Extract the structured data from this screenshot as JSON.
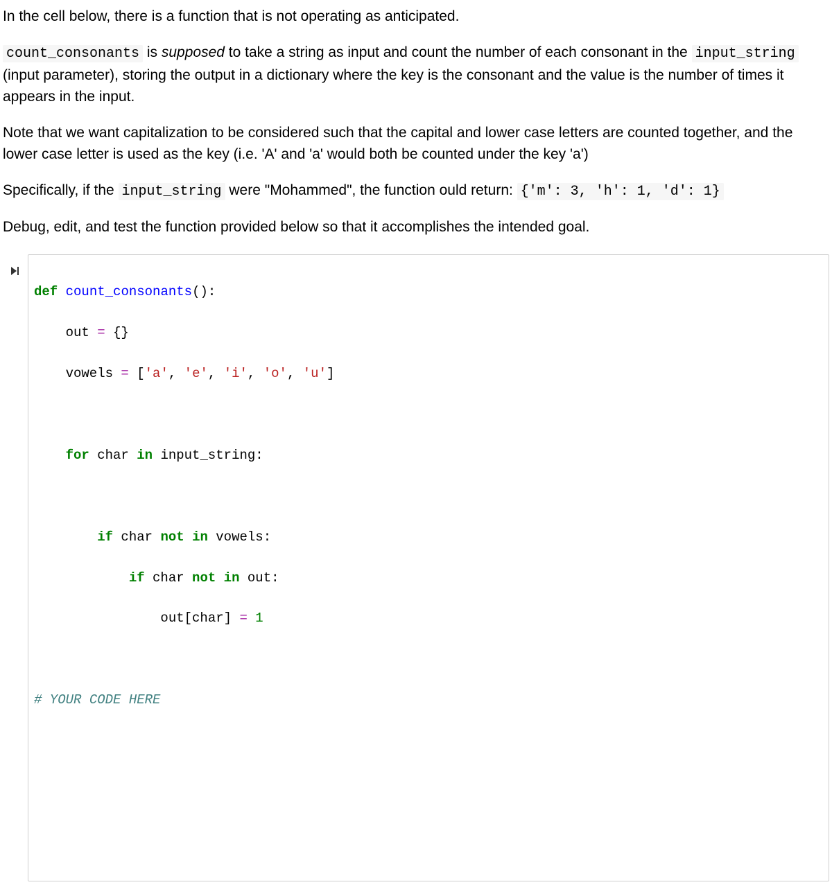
{
  "prose": {
    "p1": "In the cell below, there is a function that is not operating as anticipated.",
    "p2a": "count_consonants",
    "p2b": " is ",
    "p2c": "supposed",
    "p2d": " to take a string as input and count the number of each consonant in the ",
    "p2e": "input_string",
    "p2f": " (input parameter), storing the output in a dictionary where the key is the consonant and the value is the number of times it appears in the input.",
    "p3": "Note that we want capitalization to be considered such that the capital and lower case letters are counted together, and the lower case letter is used as the key (i.e. 'A' and 'a' would both be counted under the key 'a')",
    "p4a": "Specifically, if the ",
    "p4b": "input_string",
    "p4c": " were \"Mohammed\", the function ould return: ",
    "p4d": "{'m': 3, 'h': 1, 'd': 1}",
    "p5": "Debug, edit, and test the function provided below so that it accomplishes the intended goal."
  },
  "code": {
    "kw_def": "def",
    "fname": "count_consonants",
    "parens": "():",
    "l2a": "out ",
    "l2b": "=",
    "l2c": " {}",
    "l3a": "vowels ",
    "l3b": "=",
    "l3c": " [",
    "s_a": "'a'",
    "s_e": "'e'",
    "s_i": "'i'",
    "s_o": "'o'",
    "s_u": "'u'",
    "comma": ", ",
    "rbrack": "]",
    "kw_for": "for",
    "l5a": " char ",
    "kw_in": "in",
    "l5b": " input_string:",
    "kw_if": "if",
    "l7a": " char ",
    "kw_not": "not",
    "sp": " ",
    "l7b": " vowels:",
    "l8b": " out:",
    "l9a": "out[char] ",
    "l9b": "=",
    "l9c": " ",
    "num1": "1",
    "comment": "# YOUR CODE HERE"
  }
}
